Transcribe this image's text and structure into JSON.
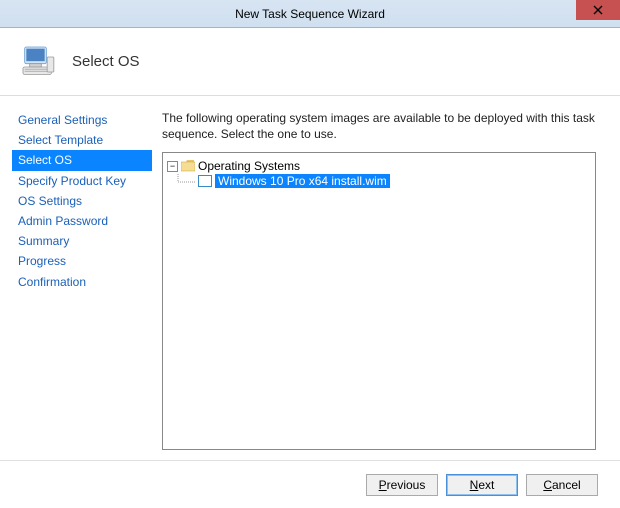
{
  "window": {
    "title": "New Task Sequence Wizard"
  },
  "header": {
    "page_title": "Select OS"
  },
  "sidebar": {
    "items": [
      {
        "label": "General Settings",
        "selected": false
      },
      {
        "label": "Select Template",
        "selected": false
      },
      {
        "label": "Select OS",
        "selected": true
      },
      {
        "label": "Specify Product Key",
        "selected": false
      },
      {
        "label": "OS Settings",
        "selected": false
      },
      {
        "label": "Admin Password",
        "selected": false
      },
      {
        "label": "Summary",
        "selected": false
      },
      {
        "label": "Progress",
        "selected": false
      },
      {
        "label": "Confirmation",
        "selected": false
      }
    ]
  },
  "main": {
    "description": "The following operating system images are available to be deployed with this task sequence.  Select the one to use.",
    "tree": {
      "root_label": "Operating Systems",
      "expanded": true,
      "children": [
        {
          "label": "Windows 10 Pro x64 install.wim",
          "selected": true
        }
      ]
    }
  },
  "footer": {
    "previous": {
      "prefix": "P",
      "rest": "revious"
    },
    "next": {
      "prefix": "N",
      "rest": "ext"
    },
    "cancel": {
      "prefix": "C",
      "rest": "ancel"
    }
  }
}
